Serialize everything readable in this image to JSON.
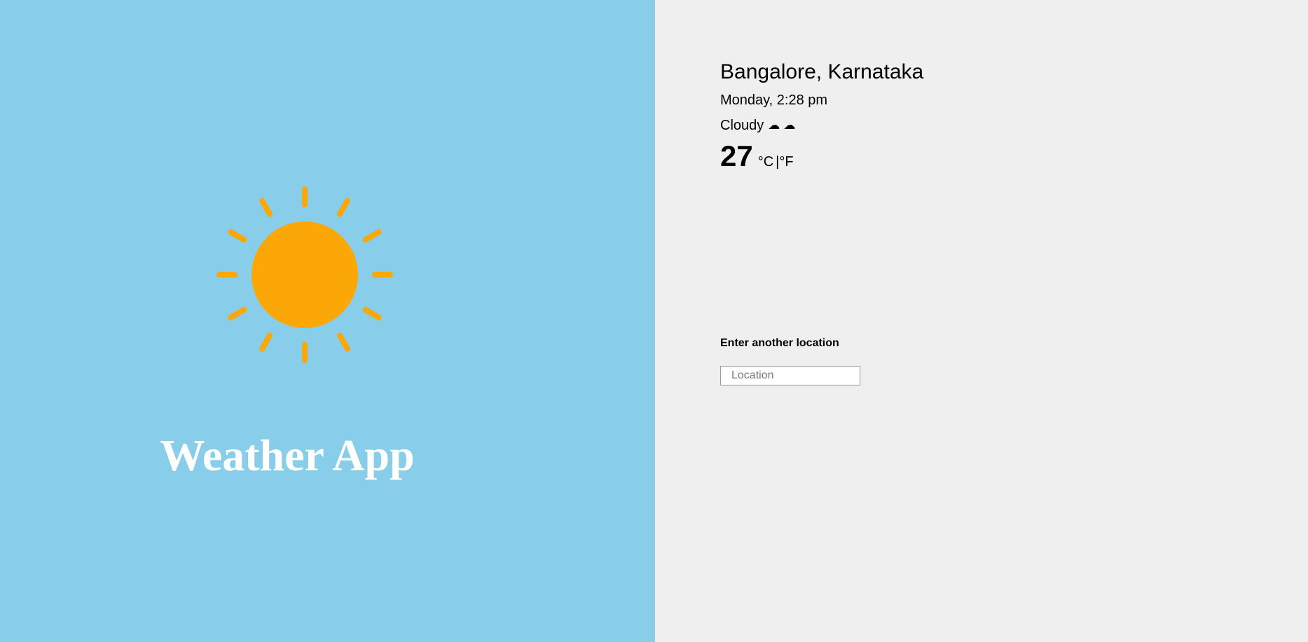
{
  "app": {
    "title": "Weather App",
    "sun_color": "#fba705",
    "left_bg": "#88ceeb",
    "right_bg": "#efefef"
  },
  "weather": {
    "location": "Bangalore, Karnataka",
    "datetime": "Monday, 2:28 pm",
    "condition": "Cloudy",
    "condition_icons": [
      "cloud-icon",
      "cloud-icon"
    ],
    "temperature": "27",
    "unit_c": "°C",
    "unit_separator": "|",
    "unit_f": "°F"
  },
  "search": {
    "label": "Enter another location",
    "placeholder": "Location",
    "value": ""
  }
}
